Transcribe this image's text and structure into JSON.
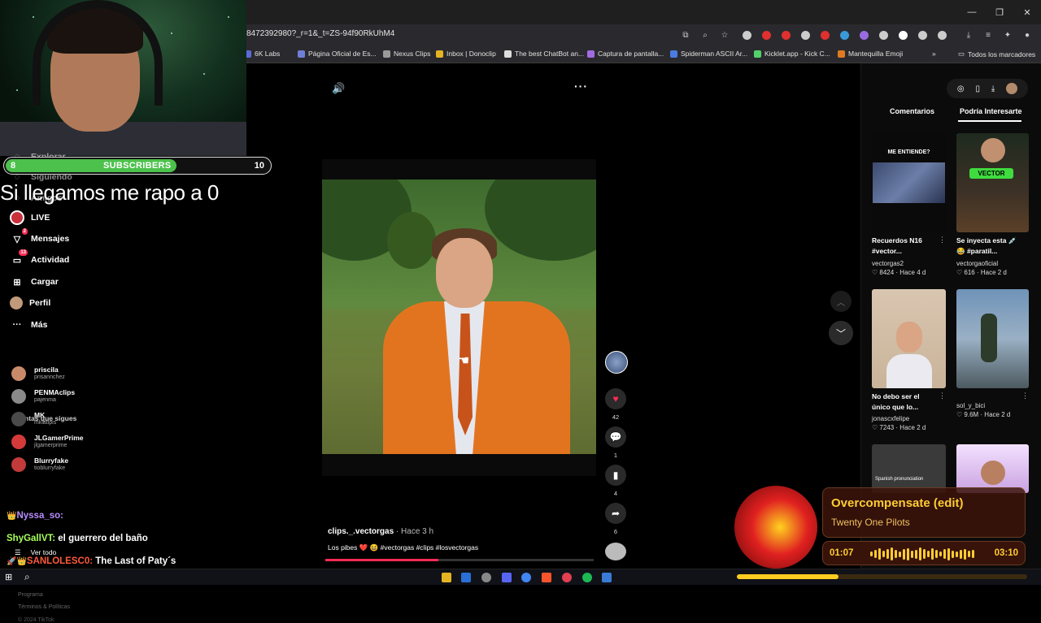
{
  "browser": {
    "url": "8472392980?_r=1&_t=ZS-94f90RkUhM4",
    "bookmarks": [
      {
        "label": "6K Labs",
        "color": "#5b6bd6"
      },
      {
        "label": "Página Oficial de Es...",
        "color": "#6e7fd8"
      },
      {
        "label": "Nexus Clips",
        "color": "#9a9a9a"
      },
      {
        "label": "Inbox | Donoclip",
        "color": "#e6b422"
      },
      {
        "label": "The best ChatBot an...",
        "color": "#dddddd"
      },
      {
        "label": "Captura de pantalla...",
        "color": "#a36be0"
      },
      {
        "label": "Spiderman ASCII Ar...",
        "color": "#4b7be0"
      },
      {
        "label": "Kicklet.app - Kick C...",
        "color": "#53d16b"
      },
      {
        "label": "Mantequilla Emoji",
        "color": "#e07a22"
      }
    ],
    "all_bookmarks": "Todos los marcadores"
  },
  "stream": {
    "subs_current": "8",
    "subs_label": "SUBSCRIBERS",
    "subs_goal": "10",
    "subs_progress": 0.8,
    "overlay_text": "Si llegamos me rapo a 0",
    "chat": [
      {
        "user": "Nyssa_so:",
        "user_color": "#b98cff",
        "msg": "",
        "prefix": "👑"
      },
      {
        "user": "ShyGallVT:",
        "user_color": "#a6ff5c",
        "msg": "el guerrero del baño",
        "prefix": ""
      },
      {
        "user": "SANLOLESC0:",
        "user_color": "#ff5a3c",
        "msg": "The Last of Paty´s",
        "prefix": "🚀👑"
      }
    ]
  },
  "sidebar": {
    "partial_top": [
      "Explorar",
      "Siguiendo",
      "Amigos"
    ],
    "items": [
      {
        "label": "LIVE",
        "icon": "live-icon",
        "badge": ""
      },
      {
        "label": "Mensajes",
        "icon": "messages-icon",
        "badge": "2"
      },
      {
        "label": "Actividad",
        "icon": "activity-icon",
        "badge": "13"
      },
      {
        "label": "Cargar",
        "icon": "upload-icon",
        "badge": ""
      },
      {
        "label": "Perfil",
        "icon": "profile-icon",
        "badge": ""
      },
      {
        "label": "Más",
        "icon": "more-icon",
        "badge": ""
      }
    ],
    "following_title": "Cuentas que sigues",
    "following": [
      {
        "name": "priscila",
        "handle": "prisannchez",
        "color": "#c98a6a"
      },
      {
        "name": "PENMAclips",
        "handle": "pajenma",
        "color": "#8a8a8a"
      },
      {
        "name": "MK",
        "handle": "mkiatipis",
        "color": "#4a4a4a"
      },
      {
        "name": "JLGamerPrime",
        "handle": "jlgamerprime",
        "color": "#d43a3a"
      },
      {
        "name": "Blurryfake",
        "handle": "tioblurryfake",
        "color": "#c23a3a"
      }
    ],
    "see_all": "Ver todo",
    "footer": [
      "Programa",
      "Términos & Políticas",
      "© 2024 TikTok"
    ]
  },
  "video": {
    "author": "clips._.vectorgas",
    "time": "Hace 3 h",
    "caption": "Los pibes ❤️ 😆 #vectorgas #clips #losvectorgas",
    "likes": "42",
    "comments": "1",
    "saves": "4",
    "shares": "6",
    "progress": 0.42
  },
  "right_panel": {
    "tabs": [
      "Comentarios",
      "Podría Interesarte"
    ],
    "videos": [
      {
        "title": "Recuerdos N16 #vector...",
        "user": "vectorgas2",
        "stats": "♡ 8424 · Hace 4 d",
        "thumb_text": "ME ENTIENDE?"
      },
      {
        "title": "Se inyecta esta 💉 😂 #paratil...",
        "user": "vectorgaoficial",
        "stats": "♡ 616 · Hace 2 d",
        "thumb_text": "VECTOR"
      },
      {
        "title": "No debo ser el único que lo...",
        "user": "jonascxfelipe",
        "stats": "♡ 7243 · Hace 2 d",
        "thumb_text": ""
      },
      {
        "title": "",
        "user": "sol_y_bici",
        "stats": "♡ 9.6M · Hace 2 d",
        "thumb_text": ""
      },
      {
        "title": "",
        "user": "",
        "stats": "",
        "thumb_text": "Spanish pronunciation"
      }
    ]
  },
  "now_playing": {
    "title": "Overcompensate (edit)",
    "artist": "Twenty One Pilots",
    "current": "01:07",
    "total": "03:10",
    "progress": 0.35
  }
}
